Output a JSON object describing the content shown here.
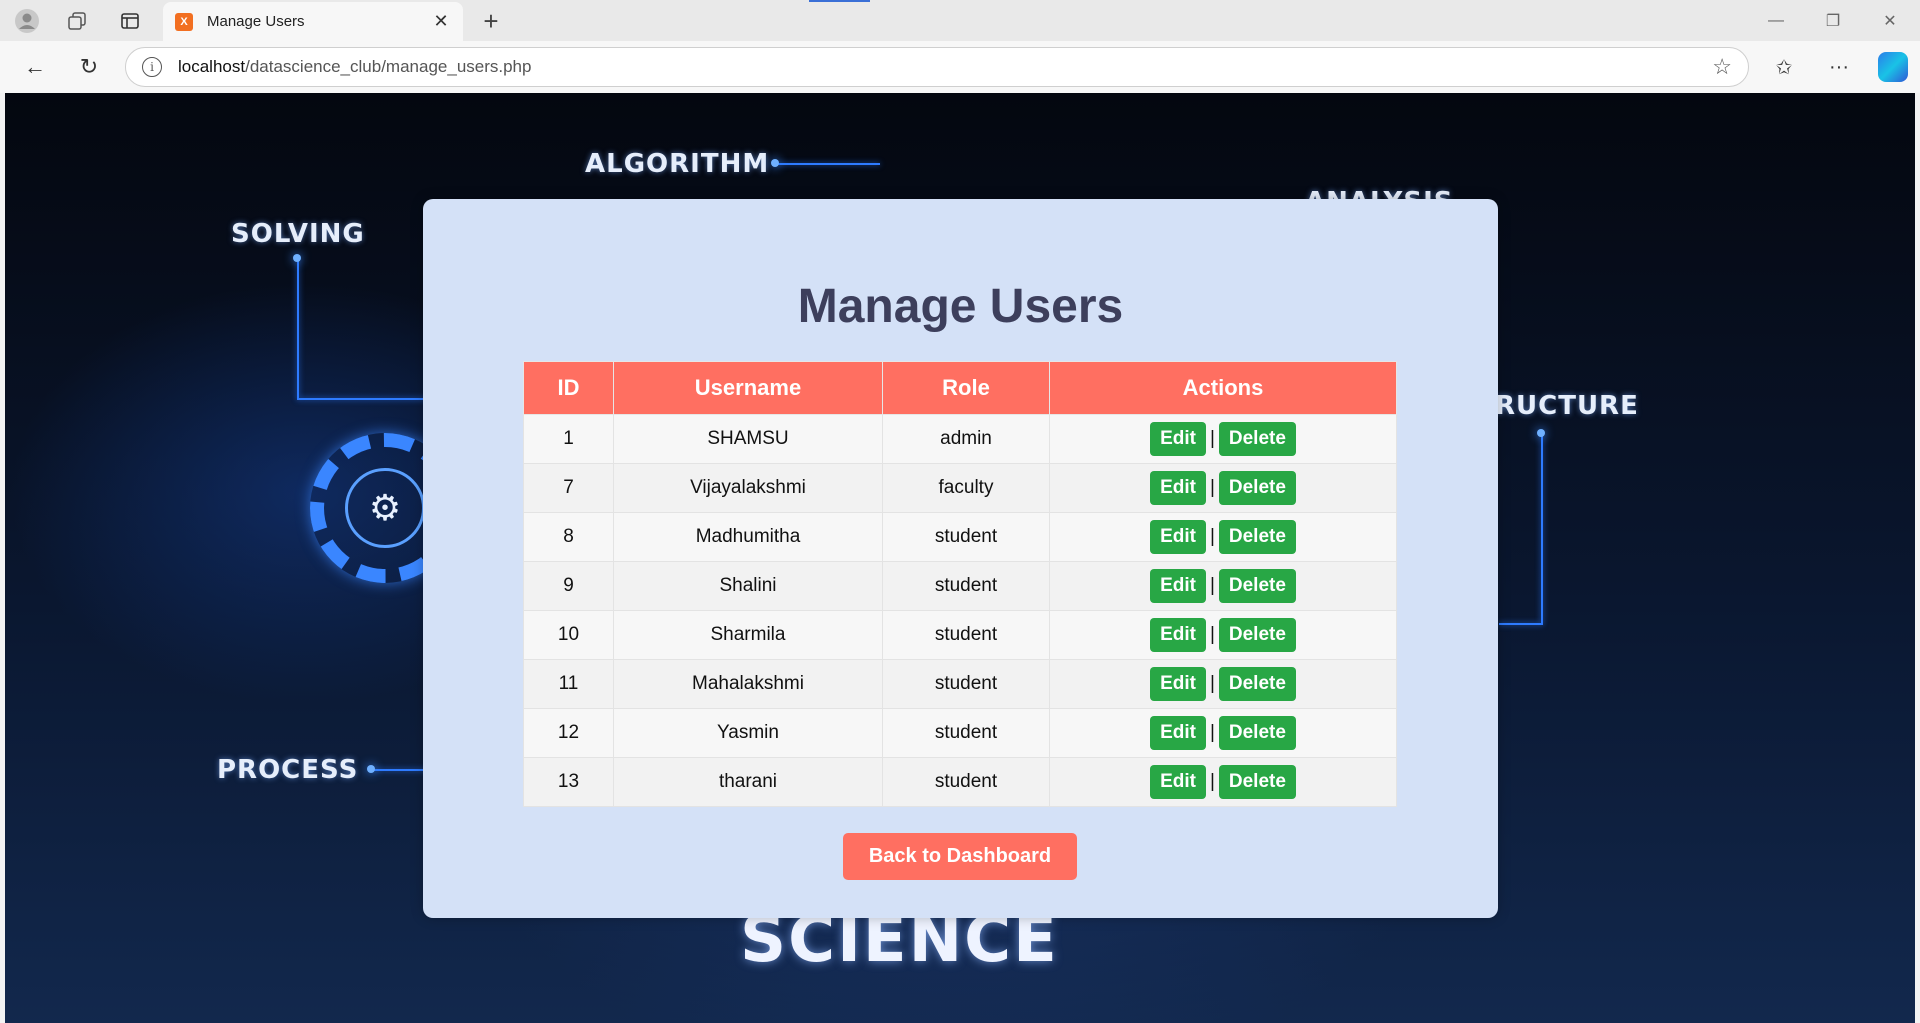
{
  "browser": {
    "tab_title": "Manage Users",
    "tab_favicon_text": "X",
    "url_host": "localhost",
    "url_path": "/datascience_club/manage_users.php"
  },
  "background": {
    "words": [
      "ALGORITHM",
      "SOLVING",
      "ANALYSIS",
      "RUCTURE",
      "PROCESS",
      "SCIENCE"
    ]
  },
  "page": {
    "title": "Manage Users",
    "columns": [
      "ID",
      "Username",
      "Role",
      "Actions"
    ],
    "edit_label": "Edit",
    "delete_label": "Delete",
    "separator": "|",
    "back_label": "Back to Dashboard",
    "users": [
      {
        "id": "1",
        "username": "SHAMSU",
        "role": "admin"
      },
      {
        "id": "7",
        "username": "Vijayalakshmi",
        "role": "faculty"
      },
      {
        "id": "8",
        "username": "Madhumitha",
        "role": "student"
      },
      {
        "id": "9",
        "username": "Shalini",
        "role": "student"
      },
      {
        "id": "10",
        "username": "Sharmila",
        "role": "student"
      },
      {
        "id": "11",
        "username": "Mahalakshmi",
        "role": "student"
      },
      {
        "id": "12",
        "username": "Yasmin",
        "role": "student"
      },
      {
        "id": "13",
        "username": "tharani",
        "role": "student"
      }
    ]
  },
  "colors": {
    "header_accent": "#ff6f61",
    "action_green": "#28a745",
    "card_bg": "#d4e1f7",
    "title_color": "#3d3f5c"
  }
}
